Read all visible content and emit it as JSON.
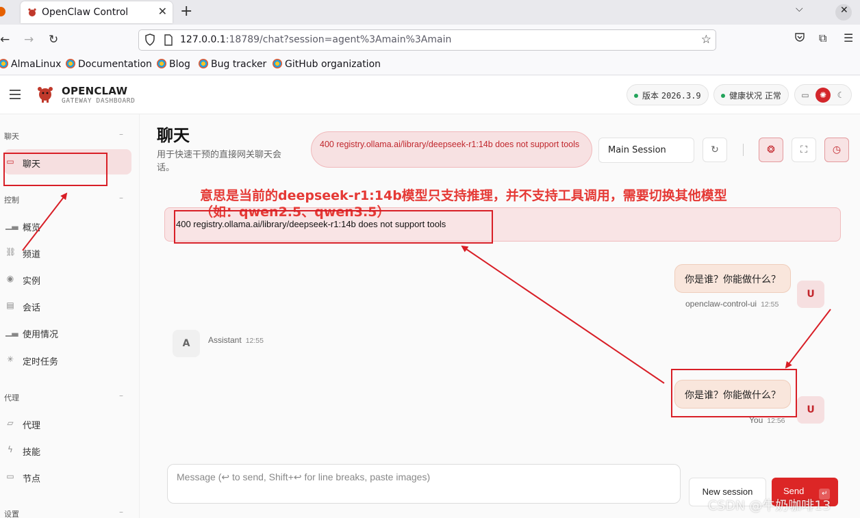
{
  "browser": {
    "tab_title": "OpenClaw Control",
    "url_host": "127.0.0.1",
    "url_rest": ":18789/chat?session=agent%3Amain%3Amain",
    "bookmarks": [
      "AlmaLinux",
      "Documentation",
      "Blog",
      "Bug tracker",
      "GitHub organization"
    ]
  },
  "header": {
    "brand": "OPENCLAW",
    "brand_sub": "GATEWAY DASHBOARD",
    "version_label": "版本",
    "version_value": "2026.3.9",
    "health_label": "健康状况",
    "health_value": "正常"
  },
  "sidebar": {
    "sections": [
      {
        "title": "聊天",
        "items": [
          {
            "label": "聊天",
            "icon": "chat-icon",
            "active": true
          }
        ]
      },
      {
        "title": "控制",
        "items": [
          {
            "label": "概览",
            "icon": "bar-chart-icon"
          },
          {
            "label": "频道",
            "icon": "link-icon"
          },
          {
            "label": "实例",
            "icon": "radio-icon"
          },
          {
            "label": "会话",
            "icon": "document-icon"
          },
          {
            "label": "使用情况",
            "icon": "bar-chart-icon"
          },
          {
            "label": "定时任务",
            "icon": "loader-icon"
          }
        ]
      },
      {
        "title": "代理",
        "items": [
          {
            "label": "代理",
            "icon": "folder-icon"
          },
          {
            "label": "技能",
            "icon": "zap-icon"
          },
          {
            "label": "节点",
            "icon": "monitor-icon"
          }
        ]
      },
      {
        "title": "设置",
        "items": []
      }
    ]
  },
  "main": {
    "title": "聊天",
    "subtitle": "用于快速干预的直接网关聊天会话。",
    "error_pill": "400 registry.ollama.ai/library/deepseek-r1:14b does not support tools",
    "session_select": "Main Session",
    "error_banner": "400 registry.ollama.ai/library/deepseek-r1:14b does not support tools",
    "messages": [
      {
        "role": "user",
        "text": "你是谁？你能做什么？",
        "sender": "openclaw-control-ui",
        "time": "12:55",
        "avatar": "U"
      },
      {
        "role": "assistant",
        "text": "",
        "sender": "Assistant",
        "time": "12:55",
        "avatar": "A"
      },
      {
        "role": "user",
        "text": "你是谁？你能做什么？",
        "sender": "You",
        "time": "12:56",
        "avatar": "U"
      }
    ],
    "composer_placeholder": "Message (↩ to send, Shift+↩ for line breaks, paste images)",
    "new_session_label": "New session",
    "send_label": "Send"
  },
  "annotation": {
    "line1": "意思是当前的deepseek-r1:14b模型只支持推理，并不支持工具调用，需要切换其他模型",
    "line2": "（如：qwen2.5、qwen3.5）",
    "color": "#e53935"
  },
  "watermark": "CSDN @牛奶咖啡13",
  "colors": {
    "accent": "#dc2626",
    "active_bg": "#f6dfe0",
    "error_bg": "#f9e4e5",
    "bubble_bg": "#f9e6dc"
  }
}
